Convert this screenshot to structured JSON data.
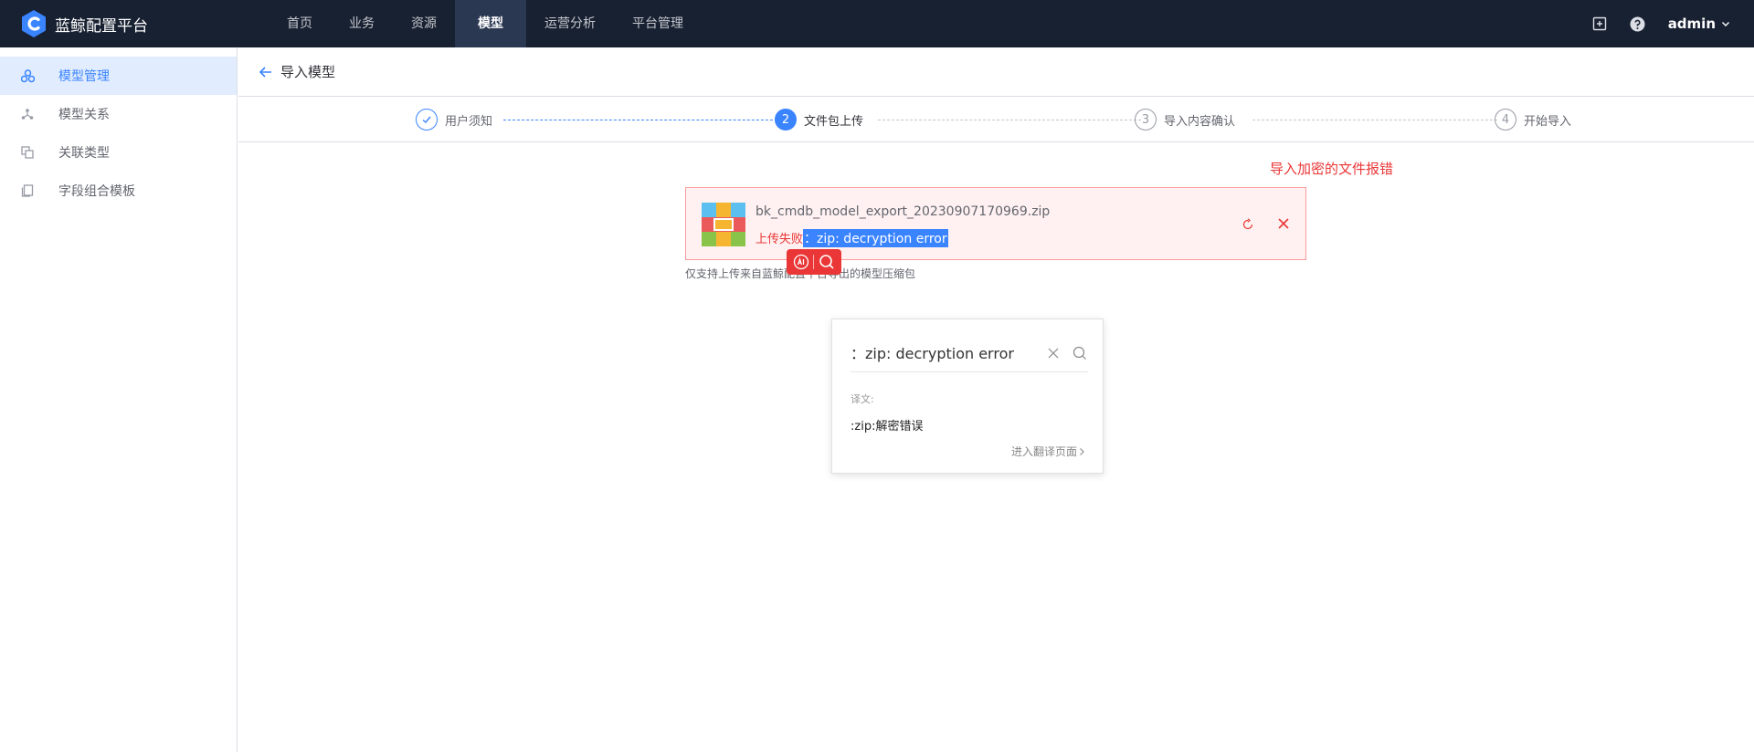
{
  "header": {
    "brand_name": "蓝鲸配置平台",
    "nav": [
      {
        "label": "首页"
      },
      {
        "label": "业务"
      },
      {
        "label": "资源"
      },
      {
        "label": "模型",
        "active": true
      },
      {
        "label": "运营分析"
      },
      {
        "label": "平台管理"
      }
    ],
    "user": "admin"
  },
  "sidebar": {
    "items": [
      {
        "label": "模型管理",
        "icon": "model-manage-icon",
        "active": true
      },
      {
        "label": "模型关系",
        "icon": "model-relation-icon"
      },
      {
        "label": "关联类型",
        "icon": "association-type-icon"
      },
      {
        "label": "字段组合模板",
        "icon": "field-template-icon"
      }
    ]
  },
  "page": {
    "title": "导入模型"
  },
  "steps": [
    {
      "number": "1",
      "label": "用户须知",
      "state": "done"
    },
    {
      "number": "2",
      "label": "文件包上传",
      "state": "current"
    },
    {
      "number": "3",
      "label": "导入内容确认",
      "state": "pending"
    },
    {
      "number": "4",
      "label": "开始导入",
      "state": "pending"
    }
  ],
  "annotation": "导入加密的文件报错",
  "upload": {
    "file_name": "bk_cmdb_model_export_20230907170969.zip",
    "fail_label": "上传失败",
    "fail_message": "：zip: decryption error",
    "tip": "仅支持上传来自蓝鲸配置平台导出的模型压缩包"
  },
  "translate": {
    "query": "：zip: decryption error",
    "label": "译文:",
    "result": ":zip:解密错误",
    "link": "进入翻译页面"
  },
  "colors": {
    "header_bg": "#182132",
    "primary": "#3a84ff",
    "danger": "#ea3636",
    "upload_bg": "#fff1f1"
  }
}
